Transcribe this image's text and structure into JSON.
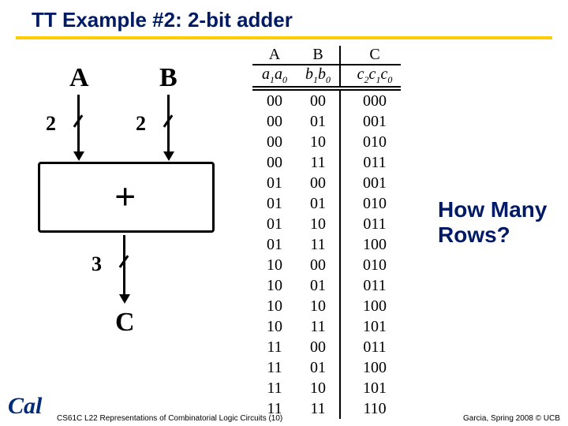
{
  "slide": {
    "title": "TT Example #2: 2-bit adder",
    "question": "How Many Rows?",
    "footer_left": "CS61C L22 Representations of Combinatorial Logic Circuits (10)",
    "footer_right": "Garcia, Spring 2008 © UCB",
    "logo": "Cal"
  },
  "diagram": {
    "labelA": "A",
    "labelB": "B",
    "labelC": "C",
    "busA": "2",
    "busB": "2",
    "busC": "3",
    "op": "+"
  },
  "table": {
    "headers": {
      "A": "A",
      "B": "B",
      "C": "C"
    },
    "subheaders": {
      "A": "a₁a₀",
      "B": "b₁b₀",
      "C": "c₂c₁c₀"
    },
    "rows": [
      {
        "A": "00",
        "B": "00",
        "C": "000"
      },
      {
        "A": "00",
        "B": "01",
        "C": "001"
      },
      {
        "A": "00",
        "B": "10",
        "C": "010"
      },
      {
        "A": "00",
        "B": "11",
        "C": "011"
      },
      {
        "A": "01",
        "B": "00",
        "C": "001"
      },
      {
        "A": "01",
        "B": "01",
        "C": "010"
      },
      {
        "A": "01",
        "B": "10",
        "C": "011"
      },
      {
        "A": "01",
        "B": "11",
        "C": "100"
      },
      {
        "A": "10",
        "B": "00",
        "C": "010"
      },
      {
        "A": "10",
        "B": "01",
        "C": "011"
      },
      {
        "A": "10",
        "B": "10",
        "C": "100"
      },
      {
        "A": "10",
        "B": "11",
        "C": "101"
      },
      {
        "A": "11",
        "B": "00",
        "C": "011"
      },
      {
        "A": "11",
        "B": "01",
        "C": "100"
      },
      {
        "A": "11",
        "B": "10",
        "C": "101"
      },
      {
        "A": "11",
        "B": "11",
        "C": "110"
      }
    ]
  }
}
